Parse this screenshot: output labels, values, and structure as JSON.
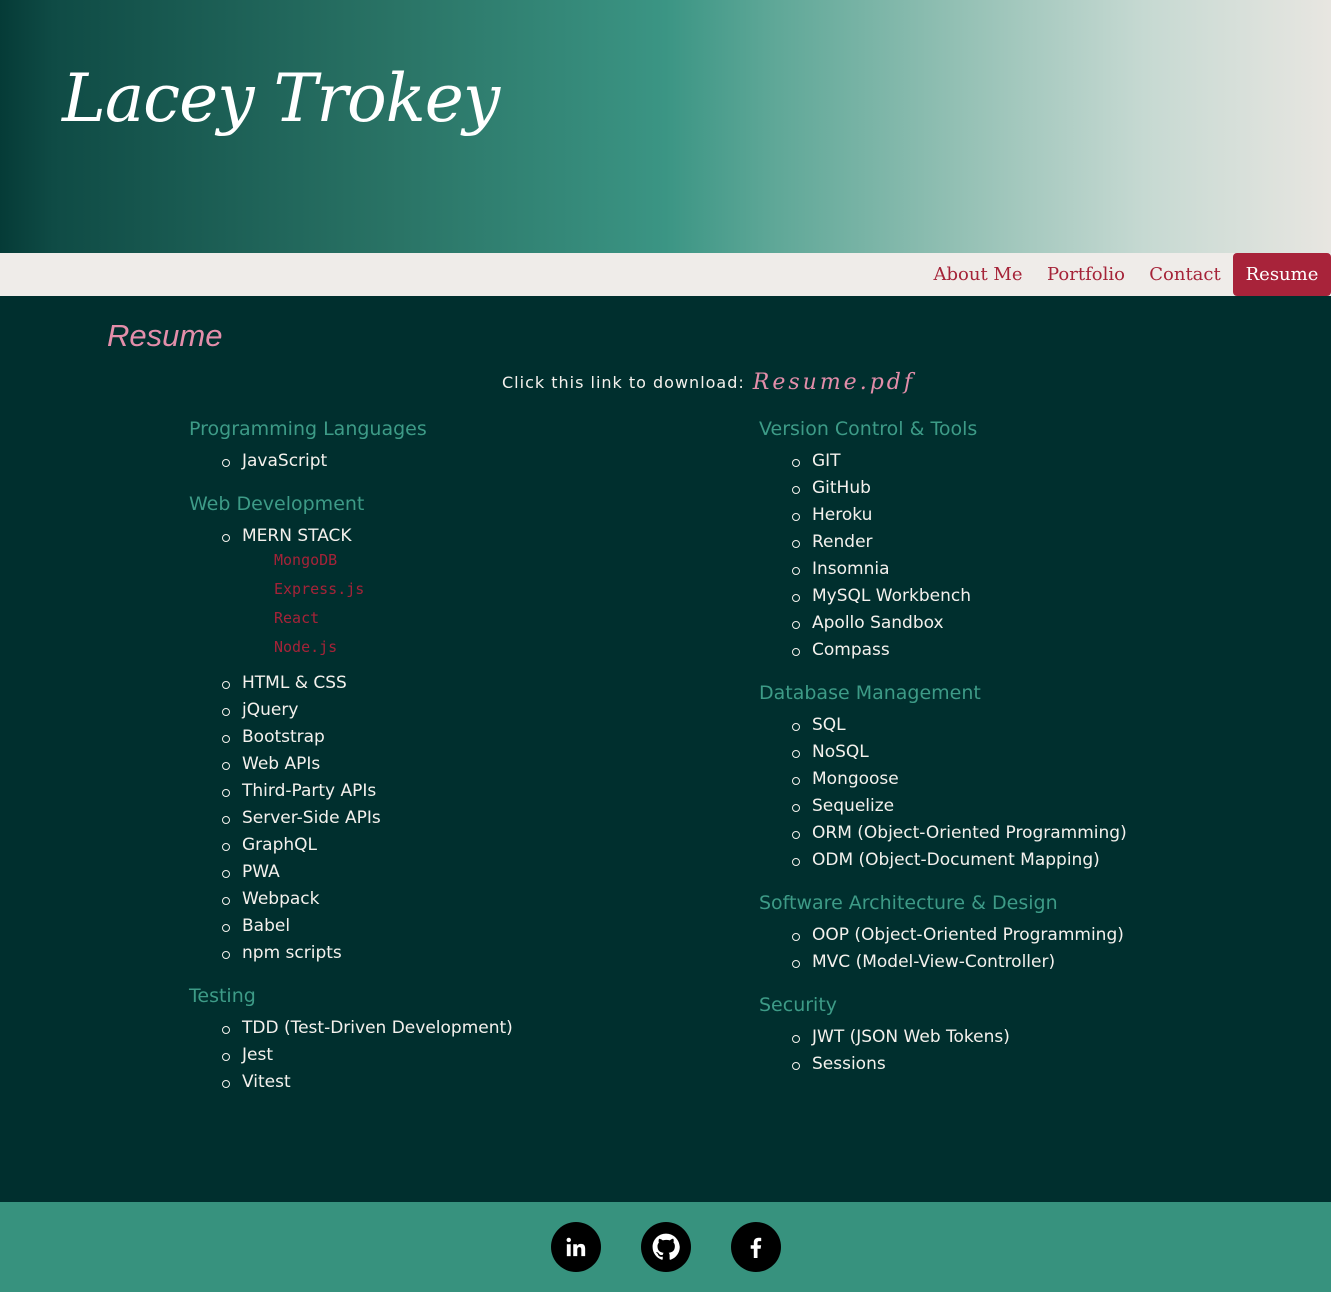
{
  "header": {
    "title": "Lacey Trokey"
  },
  "nav": {
    "items": [
      {
        "label": "About Me"
      },
      {
        "label": "Portfolio"
      },
      {
        "label": "Contact"
      },
      {
        "label": "Resume",
        "active": true
      }
    ]
  },
  "main": {
    "heading": "Resume",
    "download_text": "Click this link to download:",
    "download_link": "Resume.pdf",
    "left_column": [
      {
        "title": "Programming Languages",
        "items": [
          "JavaScript"
        ]
      },
      {
        "title": "Web Development",
        "items": [
          {
            "label": "MERN STACK",
            "subitems": [
              "MongoDB",
              "Express.js",
              "React",
              "Node.js"
            ]
          },
          "HTML & CSS",
          "jQuery",
          "Bootstrap",
          "Web APIs",
          "Third-Party APIs",
          "Server-Side APIs",
          "GraphQL",
          "PWA",
          "Webpack",
          "Babel",
          "npm scripts"
        ]
      },
      {
        "title": "Testing",
        "items": [
          "TDD (Test-Driven Development)",
          "Jest",
          "Vitest"
        ]
      }
    ],
    "right_column": [
      {
        "title": "Version Control & Tools",
        "items": [
          "GIT",
          "GitHub",
          "Heroku",
          "Render",
          "Insomnia",
          "MySQL Workbench",
          "Apollo Sandbox",
          "Compass"
        ]
      },
      {
        "title": "Database Management",
        "items": [
          "SQL",
          "NoSQL",
          "Mongoose",
          "Sequelize",
          "ORM (Object-Oriented Programming)",
          "ODM (Object-Document Mapping)"
        ]
      },
      {
        "title": "Software Architecture & Design",
        "items": [
          "OOP (Object-Oriented Programming)",
          "MVC (Model-View-Controller)"
        ]
      },
      {
        "title": "Security",
        "items": [
          "JWT (JSON Web Tokens)",
          "Sessions"
        ]
      }
    ]
  },
  "footer": {
    "social": [
      {
        "icon": "linkedin-icon"
      },
      {
        "icon": "github-icon"
      },
      {
        "icon": "facebook-icon"
      }
    ]
  },
  "colors": {
    "background": "#002f2e",
    "accent": "#a8233a",
    "section_title": "#3d9b87",
    "heading_pink": "#e38eaa",
    "footer": "#37927e"
  }
}
